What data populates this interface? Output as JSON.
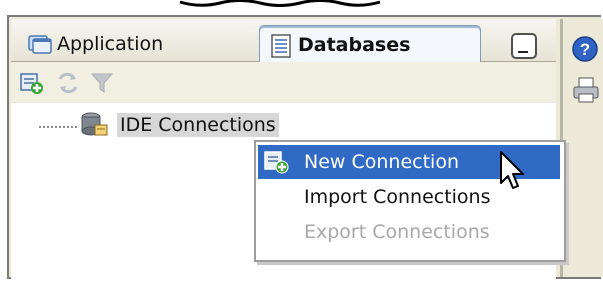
{
  "tabs": {
    "application_label": "Application",
    "databases_label": "Databases"
  },
  "tree": {
    "item_label": "IDE Connections"
  },
  "context_menu": {
    "new_connection": "New Connection",
    "import_connections": "Import Connections",
    "export_connections": "Export Connections"
  },
  "icons": {
    "application_tab": "application-icon",
    "databases_tab": "database-document-icon",
    "minimize": "minimize-icon",
    "new_connection": "new-connection-icon",
    "refresh": "refresh-icon",
    "filter": "filter-icon",
    "connection_node": "database-connection-icon",
    "help": "help-icon",
    "printer": "printer-icon",
    "cursor": "mouse-cursor-icon"
  },
  "colors": {
    "menu_highlight": "#316ac5",
    "disabled_text": "#a8a8a8",
    "panel_bg": "#ece9d8"
  }
}
